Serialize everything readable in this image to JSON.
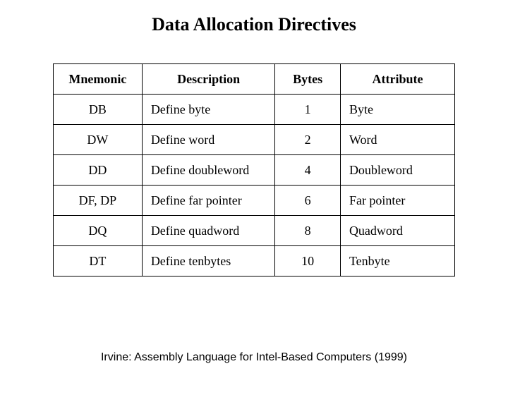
{
  "title": "Data Allocation Directives",
  "headers": {
    "mnemonic": "Mnemonic",
    "description": "Description",
    "bytes": "Bytes",
    "attribute": "Attribute"
  },
  "rows": [
    {
      "mnemonic": "DB",
      "description": "Define byte",
      "bytes": "1",
      "attribute": "Byte"
    },
    {
      "mnemonic": "DW",
      "description": "Define word",
      "bytes": "2",
      "attribute": "Word"
    },
    {
      "mnemonic": "DD",
      "description": "Define doubleword",
      "bytes": "4",
      "attribute": "Doubleword"
    },
    {
      "mnemonic": "DF, DP",
      "description": "Define far pointer",
      "bytes": "6",
      "attribute": "Far pointer"
    },
    {
      "mnemonic": "DQ",
      "description": "Define quadword",
      "bytes": "8",
      "attribute": "Quadword"
    },
    {
      "mnemonic": "DT",
      "description": "Define tenbytes",
      "bytes": "10",
      "attribute": "Tenbyte"
    }
  ],
  "footer": "Irvine: Assembly Language for Intel-Based Computers (1999)"
}
